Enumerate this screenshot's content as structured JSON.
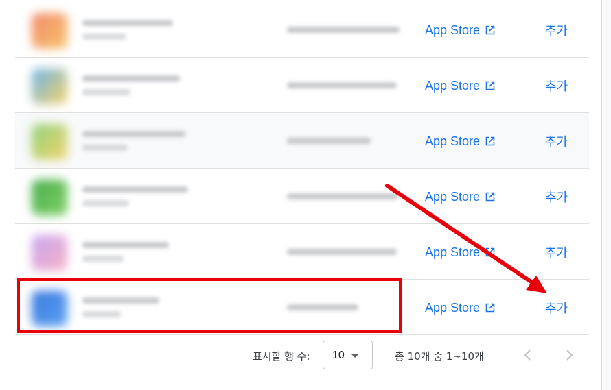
{
  "rows": [
    {
      "store_label": "App Store",
      "add_label": "추가",
      "thumb": [
        "#f28b6b",
        "#f6c26b"
      ],
      "highlighted": false
    },
    {
      "store_label": "App Store",
      "add_label": "추가",
      "thumb": [
        "#6fb4e8",
        "#f2d36b"
      ],
      "highlighted": false
    },
    {
      "store_label": "App Store",
      "add_label": "추가",
      "thumb": [
        "#8fd27b",
        "#f0d46e"
      ],
      "highlighted": true
    },
    {
      "store_label": "App Store",
      "add_label": "추가",
      "thumb": [
        "#4caf50",
        "#7ccf62"
      ],
      "highlighted": false
    },
    {
      "store_label": "App Store",
      "add_label": "추가",
      "thumb": [
        "#c9a6f0",
        "#f5b1c6"
      ],
      "highlighted": false
    },
    {
      "store_label": "App Store",
      "add_label": "추가",
      "thumb": [
        "#3b7ae0",
        "#5aa0f0"
      ],
      "highlighted": false
    }
  ],
  "pagination": {
    "rows_per_page_label": "표시할 행 수:",
    "rows_per_page_value": "10",
    "range_text": "총 10개 중 1~10개"
  },
  "colors": {
    "link": "#1a73e8",
    "annotation": "#e8000b"
  }
}
